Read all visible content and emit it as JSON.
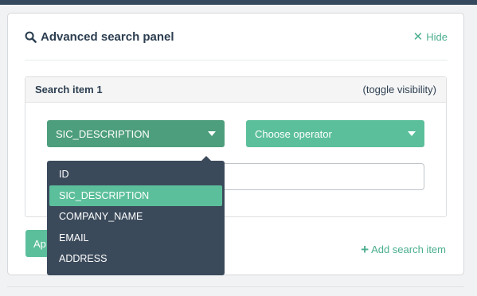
{
  "panel": {
    "title": "Advanced search panel",
    "hide_label": "Hide"
  },
  "search_item": {
    "title": "Search item 1",
    "toggle_label": "(toggle visibility)",
    "field_select": {
      "selected": "SIC_DESCRIPTION"
    },
    "operator_select": {
      "selected": "Choose operator"
    },
    "value_input": {
      "value": "",
      "placeholder": ""
    }
  },
  "apply_button": {
    "label": "Ap"
  },
  "add_search_item_label": "Add search item",
  "field_dropdown": {
    "options": [
      "ID",
      "SIC_DESCRIPTION",
      "COMPANY_NAME",
      "EMAIL",
      "ADDRESS"
    ],
    "highlighted": "SIC_DESCRIPTION"
  },
  "colors": {
    "accent": "#5cbf9c",
    "accent_dark": "#4d9e7c",
    "link": "#4aae8f",
    "dropdown_bg": "#3b4a5b",
    "text": "#2c3e50"
  },
  "icons": {
    "title_icon": "search-icon",
    "hide_icon": "close-icon",
    "add_icon": "plus-icon",
    "select_icon": "caret-down-icon"
  }
}
